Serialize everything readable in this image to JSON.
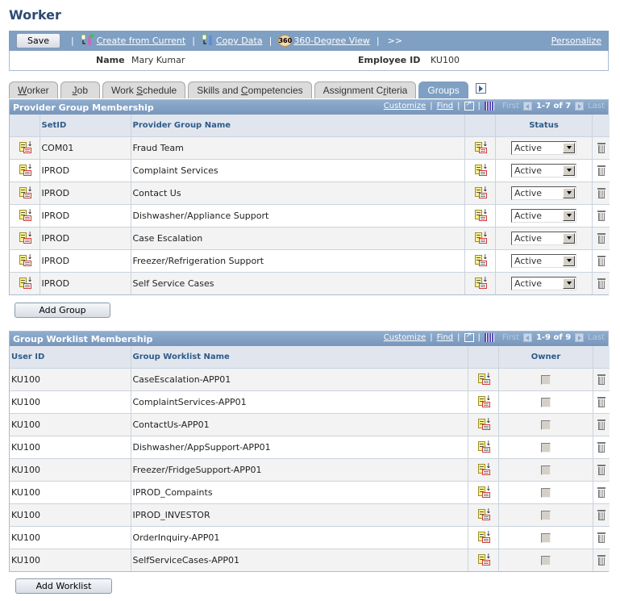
{
  "page": {
    "title": "Worker"
  },
  "toolbar": {
    "save_label": "Save",
    "create_from_current": "Create from Current",
    "copy_data": "Copy Data",
    "view_360_badge": "360",
    "view_360": "360-Degree View",
    "more": ">>",
    "personalize": "Personalize",
    "separator": "|"
  },
  "info": {
    "name_label": "Name",
    "name_value": "Mary Kumar",
    "employee_id_label": "Employee ID",
    "employee_id_value": "KU100"
  },
  "tabs": [
    {
      "label_pre": "",
      "accel": "W",
      "label_post": "orker",
      "active": false
    },
    {
      "label_pre": "",
      "accel": "J",
      "label_post": "ob",
      "active": false
    },
    {
      "label_pre": "Work ",
      "accel": "S",
      "label_post": "chedule",
      "active": false
    },
    {
      "label_pre": "Skills and ",
      "accel": "C",
      "label_post": "ompetencies",
      "active": false
    },
    {
      "label_pre": "Assignment C",
      "accel": "r",
      "label_post": "iteria",
      "active": false
    },
    {
      "label_pre": "Groups",
      "accel": "",
      "label_post": "",
      "active": true
    }
  ],
  "provider_grid": {
    "title": "Provider Group Membership",
    "nav": {
      "customize": "Customize",
      "find": "Find",
      "first": "First",
      "count": "1-7 of 7",
      "last": "Last"
    },
    "columns": {
      "setid": "SetID",
      "name": "Provider Group Name",
      "status": "Status"
    },
    "rows": [
      {
        "setid": "COM01",
        "name": "Fraud Team",
        "status": "Active"
      },
      {
        "setid": "IPROD",
        "name": "Complaint Services",
        "status": "Active"
      },
      {
        "setid": "IPROD",
        "name": "Contact Us",
        "status": "Active"
      },
      {
        "setid": "IPROD",
        "name": "Dishwasher/Appliance Support",
        "status": "Active"
      },
      {
        "setid": "IPROD",
        "name": "Case Escalation",
        "status": "Active"
      },
      {
        "setid": "IPROD",
        "name": "Freezer/Refrigeration Support",
        "status": "Active"
      },
      {
        "setid": "IPROD",
        "name": "Self Service Cases",
        "status": "Active"
      }
    ],
    "add_label": "Add Group"
  },
  "worklist_grid": {
    "title": "Group Worklist Membership",
    "nav": {
      "customize": "Customize",
      "find": "Find",
      "first": "First",
      "count": "1-9 of 9",
      "last": "Last"
    },
    "columns": {
      "user_id": "User ID",
      "name": "Group Worklist Name",
      "owner": "Owner"
    },
    "rows": [
      {
        "user_id": "KU100",
        "name": "CaseEscalation-APP01",
        "owner": false
      },
      {
        "user_id": "KU100",
        "name": "ComplaintServices-APP01",
        "owner": false
      },
      {
        "user_id": "KU100",
        "name": "ContactUs-APP01",
        "owner": false
      },
      {
        "user_id": "KU100",
        "name": "Dishwasher/AppSupport-APP01",
        "owner": false
      },
      {
        "user_id": "KU100",
        "name": "Freezer/FridgeSupport-APP01",
        "owner": false
      },
      {
        "user_id": "KU100",
        "name": "IPROD_Compaints",
        "owner": false
      },
      {
        "user_id": "KU100",
        "name": "IPROD_INVESTOR",
        "owner": false
      },
      {
        "user_id": "KU100",
        "name": "OrderInquiry-APP01",
        "owner": false
      },
      {
        "user_id": "KU100",
        "name": "SelfServiceCases-APP01",
        "owner": false
      }
    ],
    "add_label": "Add Worklist"
  }
}
